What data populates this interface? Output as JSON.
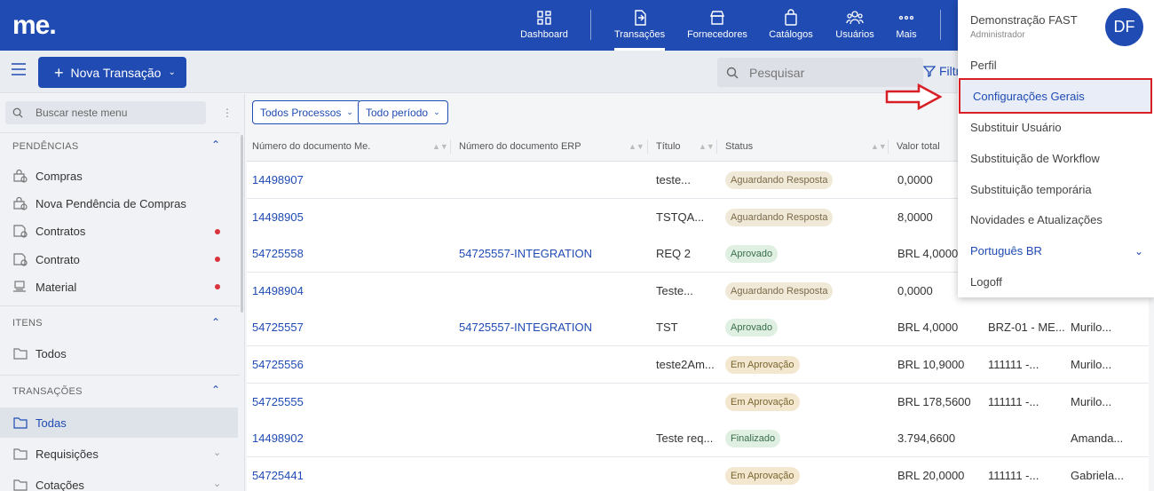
{
  "topbar": {
    "logo": "me.",
    "nav": [
      {
        "label": "Dashboard",
        "icon": "dashboard-icon"
      },
      {
        "label": "Transações",
        "icon": "transactions-icon",
        "active": true
      },
      {
        "label": "Fornecedores",
        "icon": "suppliers-icon"
      },
      {
        "label": "Catálogos",
        "icon": "catalog-bag-icon"
      },
      {
        "label": "Usuários",
        "icon": "users-icon"
      },
      {
        "label": "Mais",
        "icon": "more-dots-icon"
      }
    ]
  },
  "subbar": {
    "new_button": "Nova Transação",
    "search_placeholder": "Pesquisar",
    "filter_label": "Filtr"
  },
  "sidebar": {
    "search_placeholder": "Buscar neste menu",
    "sections": [
      {
        "title": "PENDÊNCIAS",
        "items": [
          "Compras",
          "Nova Pendência de Compras",
          "Contratos",
          "Contrato",
          "Material"
        ]
      },
      {
        "title": "ITENS",
        "items": [
          "Todos"
        ]
      },
      {
        "title": "TRANSAÇÕES",
        "items": [
          "Todas",
          "Requisições",
          "Cotações"
        ]
      }
    ]
  },
  "filters": {
    "process": "Todos Processos",
    "period": "Todo período"
  },
  "table": {
    "headers": [
      "Número do documento Me.",
      "Número do documento ERP",
      "Título",
      "Status",
      "Valor total"
    ],
    "rows": [
      {
        "doc": "14498907",
        "erp": "",
        "title": "teste...",
        "status": "Aguardando Resposta",
        "value": "0,0000",
        "c6": "",
        "c7": ""
      },
      {
        "doc": "14498905",
        "erp": "",
        "title": "TSTQA...",
        "status": "Aguardando Resposta",
        "value": "8,0000",
        "c6": "",
        "c7": ""
      },
      {
        "doc": "54725558",
        "erp": "54725557-INTEGRATION",
        "title": "REQ 2",
        "status": "Aprovado",
        "value": "BRL 4,0000",
        "c6": "",
        "c7": ""
      },
      {
        "doc": "14498904",
        "erp": "",
        "title": "Teste...",
        "status": "Aguardando Resposta",
        "value": "0,0000",
        "c6": "",
        "c7": ""
      },
      {
        "doc": "54725557",
        "erp": "54725557-INTEGRATION",
        "title": "TST",
        "status": "Aprovado",
        "value": "BRL 4,0000",
        "c6": "BRZ-01 - ME...",
        "c7": "Murilo..."
      },
      {
        "doc": "54725556",
        "erp": "",
        "title": "teste2Am...",
        "status": "Em Aprovação",
        "value": "BRL 10,9000",
        "c6": "111111 -...",
        "c7": "Murilo..."
      },
      {
        "doc": "54725555",
        "erp": "",
        "title": "",
        "status": "Em Aprovação",
        "value": "BRL 178,5600",
        "c6": "111111 -...",
        "c7": "Murilo..."
      },
      {
        "doc": "14498902",
        "erp": "",
        "title": "Teste req...",
        "status": "Finalizado",
        "value": "3.794,6600",
        "c6": "",
        "c7": "Amanda..."
      },
      {
        "doc": "54725441",
        "erp": "",
        "title": "",
        "status": "Em Aprovação",
        "value": "BRL 20,0000",
        "c6": "111111 -...",
        "c7": "Gabriela..."
      }
    ]
  },
  "user_menu": {
    "name": "Demonstração FAST",
    "role": "Administrador",
    "initials": "DF",
    "items": [
      "Perfil",
      "Configurações Gerais",
      "Substituir Usuário",
      "Substituição de Workflow",
      "Substituição temporária",
      "Novidades e Atualizações",
      "Português BR",
      "Logoff"
    ]
  },
  "colors": {
    "brand": "#1f4bb3",
    "highlight": "#d81f26",
    "alert_dot": "#d9323b"
  }
}
